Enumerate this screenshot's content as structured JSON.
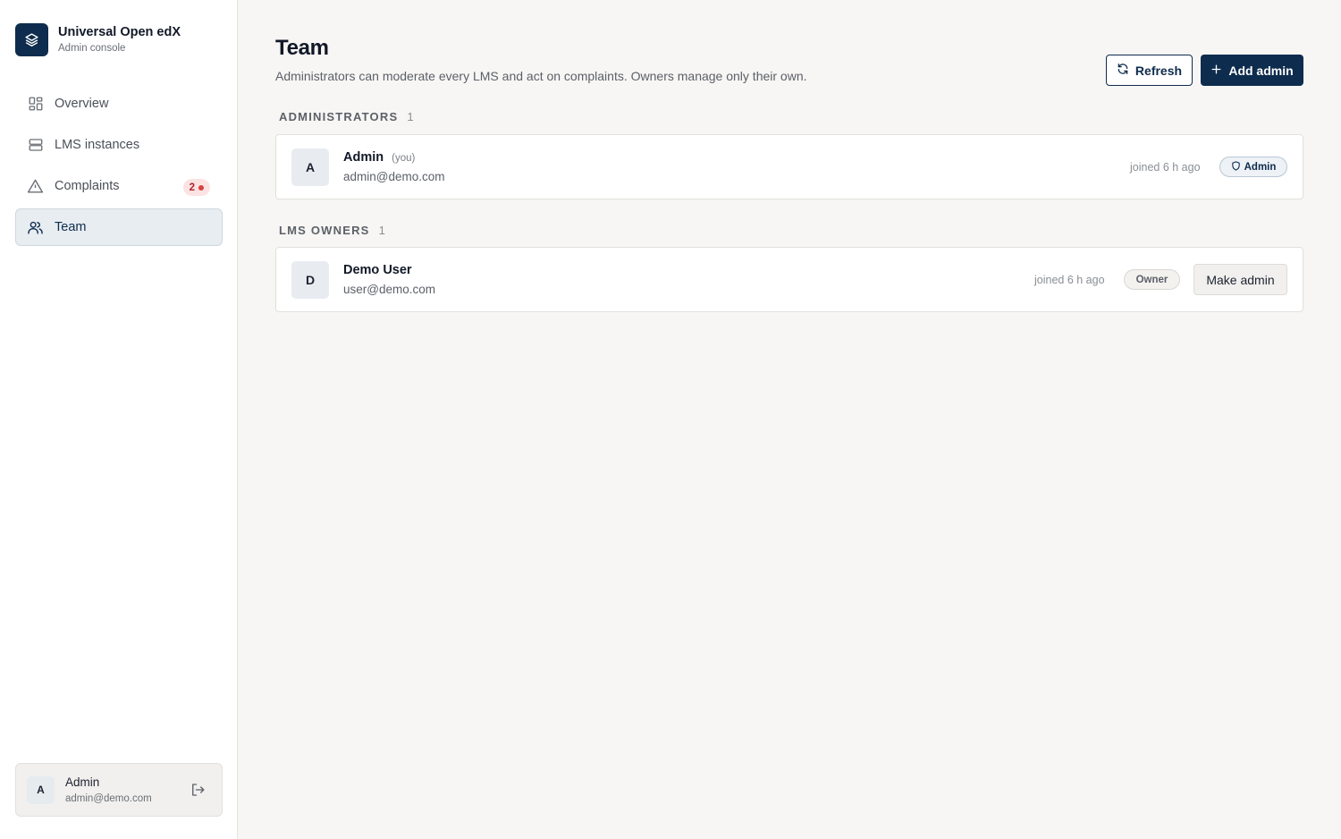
{
  "brand": {
    "title": "Universal Open edX",
    "subtitle": "Admin console"
  },
  "nav": {
    "items": [
      {
        "label": "Overview",
        "icon": "grid-icon"
      },
      {
        "label": "LMS instances",
        "icon": "server-icon"
      },
      {
        "label": "Complaints",
        "icon": "warning-icon",
        "badge": "2"
      },
      {
        "label": "Team",
        "icon": "users-icon",
        "active": true
      }
    ]
  },
  "current_user": {
    "initial": "A",
    "name": "Admin",
    "email": "admin@demo.com"
  },
  "header": {
    "title": "Team",
    "description": "Administrators can moderate every LMS and act on complaints. Owners manage only their own.",
    "refresh_label": "Refresh",
    "add_admin_label": "Add admin"
  },
  "sections": {
    "administrators": {
      "heading": "ADMINISTRATORS",
      "count": "1",
      "members": [
        {
          "initial": "A",
          "name": "Admin",
          "you_tag": "(you)",
          "email": "admin@demo.com",
          "joined": "joined 6 h ago",
          "role": "Admin"
        }
      ]
    },
    "owners": {
      "heading": "LMS OWNERS",
      "count": "1",
      "members": [
        {
          "initial": "D",
          "name": "Demo User",
          "email": "user@demo.com",
          "joined": "joined 6 h ago",
          "role": "Owner",
          "action_label": "Make admin"
        }
      ]
    }
  },
  "colors": {
    "primary": "#0e2c4d",
    "background": "#f7f6f4",
    "badge_red": "#d9413f",
    "active_nav": "#e8edf2"
  }
}
